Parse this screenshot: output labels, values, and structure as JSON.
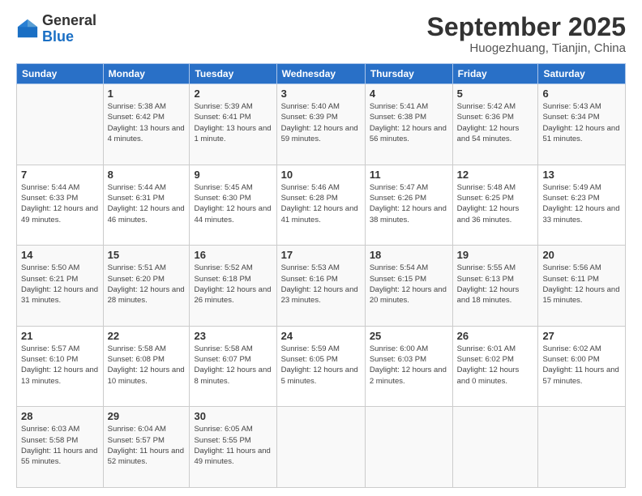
{
  "header": {
    "logo_general": "General",
    "logo_blue": "Blue",
    "month_title": "September 2025",
    "subtitle": "Huogezhuang, Tianjin, China"
  },
  "weekdays": [
    "Sunday",
    "Monday",
    "Tuesday",
    "Wednesday",
    "Thursday",
    "Friday",
    "Saturday"
  ],
  "weeks": [
    [
      {
        "day": "",
        "sunrise": "",
        "sunset": "",
        "daylight": ""
      },
      {
        "day": "1",
        "sunrise": "Sunrise: 5:38 AM",
        "sunset": "Sunset: 6:42 PM",
        "daylight": "Daylight: 13 hours and 4 minutes."
      },
      {
        "day": "2",
        "sunrise": "Sunrise: 5:39 AM",
        "sunset": "Sunset: 6:41 PM",
        "daylight": "Daylight: 13 hours and 1 minute."
      },
      {
        "day": "3",
        "sunrise": "Sunrise: 5:40 AM",
        "sunset": "Sunset: 6:39 PM",
        "daylight": "Daylight: 12 hours and 59 minutes."
      },
      {
        "day": "4",
        "sunrise": "Sunrise: 5:41 AM",
        "sunset": "Sunset: 6:38 PM",
        "daylight": "Daylight: 12 hours and 56 minutes."
      },
      {
        "day": "5",
        "sunrise": "Sunrise: 5:42 AM",
        "sunset": "Sunset: 6:36 PM",
        "daylight": "Daylight: 12 hours and 54 minutes."
      },
      {
        "day": "6",
        "sunrise": "Sunrise: 5:43 AM",
        "sunset": "Sunset: 6:34 PM",
        "daylight": "Daylight: 12 hours and 51 minutes."
      }
    ],
    [
      {
        "day": "7",
        "sunrise": "Sunrise: 5:44 AM",
        "sunset": "Sunset: 6:33 PM",
        "daylight": "Daylight: 12 hours and 49 minutes."
      },
      {
        "day": "8",
        "sunrise": "Sunrise: 5:44 AM",
        "sunset": "Sunset: 6:31 PM",
        "daylight": "Daylight: 12 hours and 46 minutes."
      },
      {
        "day": "9",
        "sunrise": "Sunrise: 5:45 AM",
        "sunset": "Sunset: 6:30 PM",
        "daylight": "Daylight: 12 hours and 44 minutes."
      },
      {
        "day": "10",
        "sunrise": "Sunrise: 5:46 AM",
        "sunset": "Sunset: 6:28 PM",
        "daylight": "Daylight: 12 hours and 41 minutes."
      },
      {
        "day": "11",
        "sunrise": "Sunrise: 5:47 AM",
        "sunset": "Sunset: 6:26 PM",
        "daylight": "Daylight: 12 hours and 38 minutes."
      },
      {
        "day": "12",
        "sunrise": "Sunrise: 5:48 AM",
        "sunset": "Sunset: 6:25 PM",
        "daylight": "Daylight: 12 hours and 36 minutes."
      },
      {
        "day": "13",
        "sunrise": "Sunrise: 5:49 AM",
        "sunset": "Sunset: 6:23 PM",
        "daylight": "Daylight: 12 hours and 33 minutes."
      }
    ],
    [
      {
        "day": "14",
        "sunrise": "Sunrise: 5:50 AM",
        "sunset": "Sunset: 6:21 PM",
        "daylight": "Daylight: 12 hours and 31 minutes."
      },
      {
        "day": "15",
        "sunrise": "Sunrise: 5:51 AM",
        "sunset": "Sunset: 6:20 PM",
        "daylight": "Daylight: 12 hours and 28 minutes."
      },
      {
        "day": "16",
        "sunrise": "Sunrise: 5:52 AM",
        "sunset": "Sunset: 6:18 PM",
        "daylight": "Daylight: 12 hours and 26 minutes."
      },
      {
        "day": "17",
        "sunrise": "Sunrise: 5:53 AM",
        "sunset": "Sunset: 6:16 PM",
        "daylight": "Daylight: 12 hours and 23 minutes."
      },
      {
        "day": "18",
        "sunrise": "Sunrise: 5:54 AM",
        "sunset": "Sunset: 6:15 PM",
        "daylight": "Daylight: 12 hours and 20 minutes."
      },
      {
        "day": "19",
        "sunrise": "Sunrise: 5:55 AM",
        "sunset": "Sunset: 6:13 PM",
        "daylight": "Daylight: 12 hours and 18 minutes."
      },
      {
        "day": "20",
        "sunrise": "Sunrise: 5:56 AM",
        "sunset": "Sunset: 6:11 PM",
        "daylight": "Daylight: 12 hours and 15 minutes."
      }
    ],
    [
      {
        "day": "21",
        "sunrise": "Sunrise: 5:57 AM",
        "sunset": "Sunset: 6:10 PM",
        "daylight": "Daylight: 12 hours and 13 minutes."
      },
      {
        "day": "22",
        "sunrise": "Sunrise: 5:58 AM",
        "sunset": "Sunset: 6:08 PM",
        "daylight": "Daylight: 12 hours and 10 minutes."
      },
      {
        "day": "23",
        "sunrise": "Sunrise: 5:58 AM",
        "sunset": "Sunset: 6:07 PM",
        "daylight": "Daylight: 12 hours and 8 minutes."
      },
      {
        "day": "24",
        "sunrise": "Sunrise: 5:59 AM",
        "sunset": "Sunset: 6:05 PM",
        "daylight": "Daylight: 12 hours and 5 minutes."
      },
      {
        "day": "25",
        "sunrise": "Sunrise: 6:00 AM",
        "sunset": "Sunset: 6:03 PM",
        "daylight": "Daylight: 12 hours and 2 minutes."
      },
      {
        "day": "26",
        "sunrise": "Sunrise: 6:01 AM",
        "sunset": "Sunset: 6:02 PM",
        "daylight": "Daylight: 12 hours and 0 minutes."
      },
      {
        "day": "27",
        "sunrise": "Sunrise: 6:02 AM",
        "sunset": "Sunset: 6:00 PM",
        "daylight": "Daylight: 11 hours and 57 minutes."
      }
    ],
    [
      {
        "day": "28",
        "sunrise": "Sunrise: 6:03 AM",
        "sunset": "Sunset: 5:58 PM",
        "daylight": "Daylight: 11 hours and 55 minutes."
      },
      {
        "day": "29",
        "sunrise": "Sunrise: 6:04 AM",
        "sunset": "Sunset: 5:57 PM",
        "daylight": "Daylight: 11 hours and 52 minutes."
      },
      {
        "day": "30",
        "sunrise": "Sunrise: 6:05 AM",
        "sunset": "Sunset: 5:55 PM",
        "daylight": "Daylight: 11 hours and 49 minutes."
      },
      {
        "day": "",
        "sunrise": "",
        "sunset": "",
        "daylight": ""
      },
      {
        "day": "",
        "sunrise": "",
        "sunset": "",
        "daylight": ""
      },
      {
        "day": "",
        "sunrise": "",
        "sunset": "",
        "daylight": ""
      },
      {
        "day": "",
        "sunrise": "",
        "sunset": "",
        "daylight": ""
      }
    ]
  ]
}
